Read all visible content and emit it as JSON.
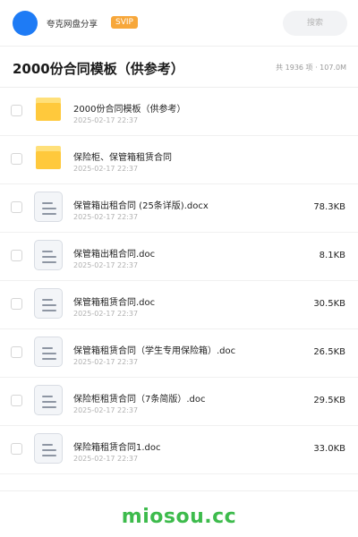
{
  "topbar": {
    "share_title": "夸克网盘分享",
    "badge": "SVIP",
    "search_placeholder": "搜索"
  },
  "header": {
    "title": "2000份合同模板（供参考）",
    "summary": "共 1936 项 · 107.0M"
  },
  "files": [
    {
      "type": "folder",
      "name": "2000份合同模板（供参考）",
      "date": "2025-02-17 22:37",
      "size": ""
    },
    {
      "type": "folder",
      "name": "保险柜、保管箱租赁合同",
      "date": "2025-02-17 22:37",
      "size": ""
    },
    {
      "type": "doc",
      "name": "保管箱出租合同 (25条详版).docx",
      "date": "2025-02-17 22:37",
      "size": "78.3KB"
    },
    {
      "type": "doc",
      "name": "保管箱出租合同.doc",
      "date": "2025-02-17 22:37",
      "size": "8.1KB"
    },
    {
      "type": "doc",
      "name": "保管箱租赁合同.doc",
      "date": "2025-02-17 22:37",
      "size": "30.5KB"
    },
    {
      "type": "doc",
      "name": "保管箱租赁合同（学生专用保险箱）.doc",
      "date": "2025-02-17 22:37",
      "size": "26.5KB"
    },
    {
      "type": "doc",
      "name": "保险柜租赁合同（7条简版）.doc",
      "date": "2025-02-17 22:37",
      "size": "29.5KB"
    },
    {
      "type": "doc",
      "name": "保险箱租赁合同1.doc",
      "date": "2025-02-17 22:37",
      "size": "33.0KB"
    }
  ],
  "icons": {
    "folder": "folder-icon",
    "doc": "document-icon"
  },
  "colors": {
    "accent": "#1e7bf5",
    "svip": "#f7a73a",
    "folder": "#ffc93c",
    "watermark": "#3dbb4c"
  },
  "watermark": "miosou.cc"
}
